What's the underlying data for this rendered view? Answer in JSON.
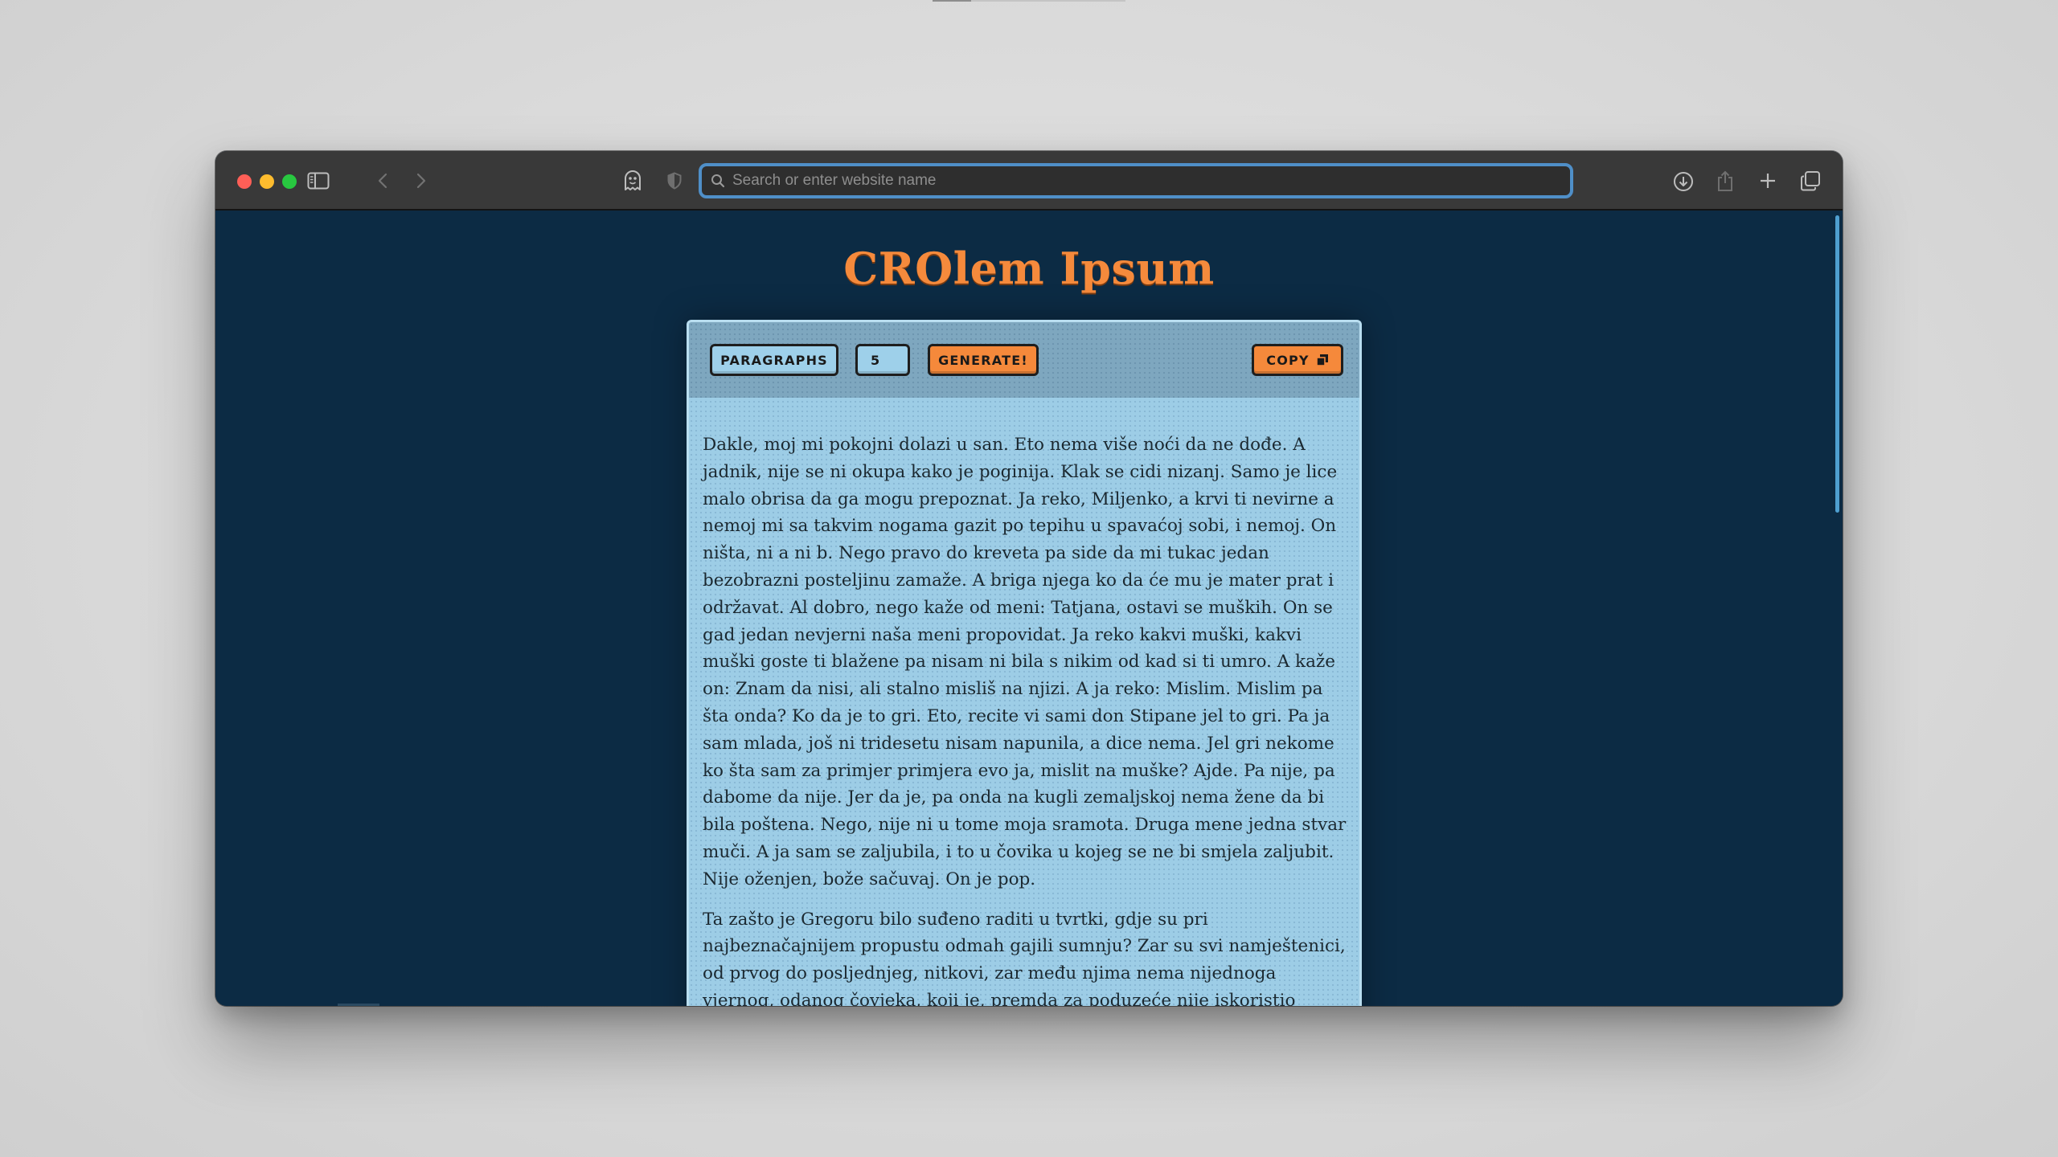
{
  "browser": {
    "address_placeholder": "Search or enter website name"
  },
  "page": {
    "title": "CROlem Ipsum",
    "controls": {
      "unit_label": "PARAGRAPHS",
      "count_value": "5",
      "generate_label": "GENERATE!",
      "copy_label": "COPY"
    },
    "paragraphs": [
      "Dakle, moj mi pokojni dolazi u san. Eto nema više noći da ne dođe. A jadnik, nije se ni okupa kako je poginija. Klak se cidi nizanj. Samo je lice malo obrisa da ga mogu prepoznat. Ja reko, Miljenko, a krvi ti nevirne a nemoj mi sa takvim nogama gazit po tepihu u spavaćoj sobi, i nemoj. On ništa, ni a ni b. Nego pravo do kreveta pa side da mi tukac jedan bezobrazni posteljinu zamaže. A briga njega ko da će mu je mater prat i održavat. Al dobro, nego kaže od meni: Tatjana, ostavi se muških. On se gad jedan nevjerni naša meni propovidat. Ja reko kakvi muški, kakvi muški goste ti blažene pa nisam ni bila s nikim od kad si ti umro. A kaže on: Znam da nisi, ali stalno misliš na njizi. A ja reko: Mislim. Mislim pa šta onda? Ko da je to gri. Eto, recite vi sami don Stipane jel to gri. Pa ja sam mlada, još ni tridesetu nisam napunila, a dice nema. Jel gri nekome ko šta sam za primjer primjera evo ja, mislit na muške? Ajde. Pa nije, pa dabome da nije. Jer da je, pa onda na kugli zemaljskoj nema žene da bi bila poštena. Nego, nije ni u tome moja sramota. Druga mene jedna stvar muči. A ja sam se zaljubila, i to u čovika u kojeg se ne bi smjela zaljubit. Nije oženjen, bože sačuvaj. On je pop.",
      "Ta zašto je Gregoru bilo suđeno raditi u tvrtki, gdje su pri najbeznačajnijem propustu odmah gajili sumnju? Zar su svi namještenici, od prvog do posljednjeg, nitkovi, zar među njima nema nijednoga vjernog, odanog čovjeka, koji je, premda za poduzeće nije iskoristio svega nekoliko"
    ]
  }
}
